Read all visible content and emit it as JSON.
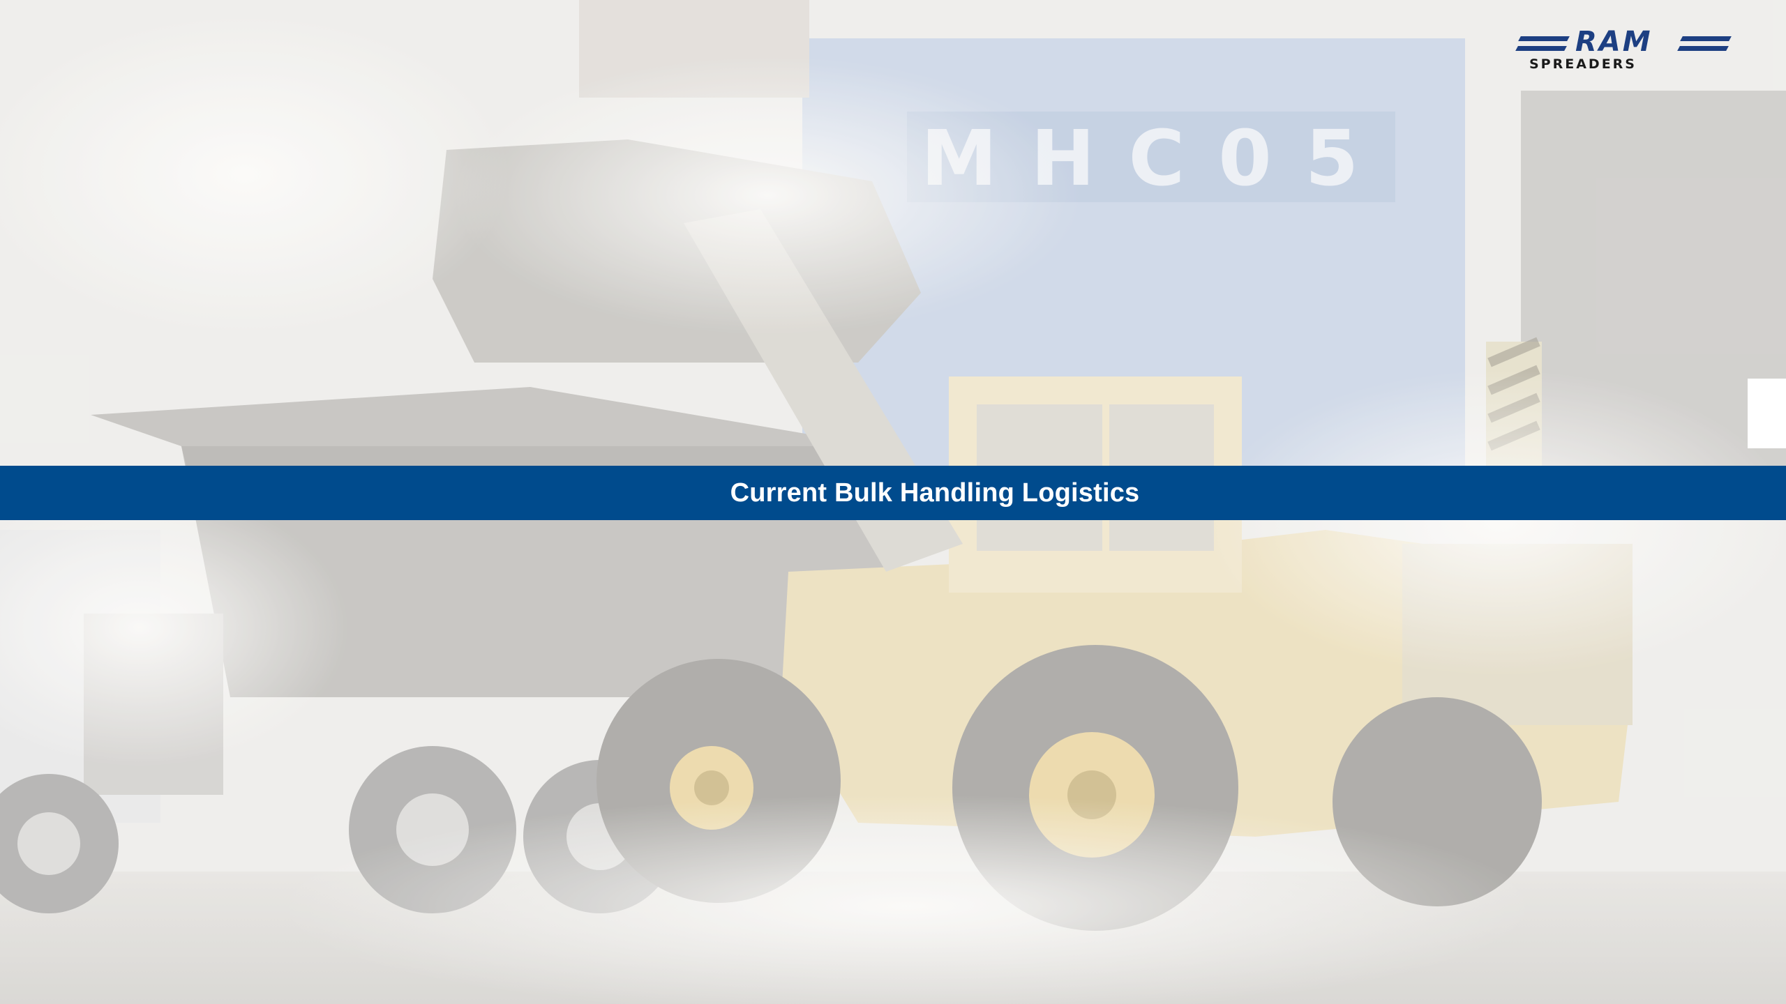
{
  "slide": {
    "title": "Current Bulk Handling Logistics",
    "background_label": "MHC05"
  },
  "logo": {
    "name": "RAM",
    "subtitle": "SPREADERS"
  },
  "colors": {
    "title_band": "#004b8d",
    "title_text": "#ffffff",
    "logo_blue": "#1d3f82",
    "logo_text_dark": "#1a1a1a"
  },
  "icons": {
    "logo": "ram-spreaders-logo",
    "background": "wheel-loader-truck-photo"
  }
}
